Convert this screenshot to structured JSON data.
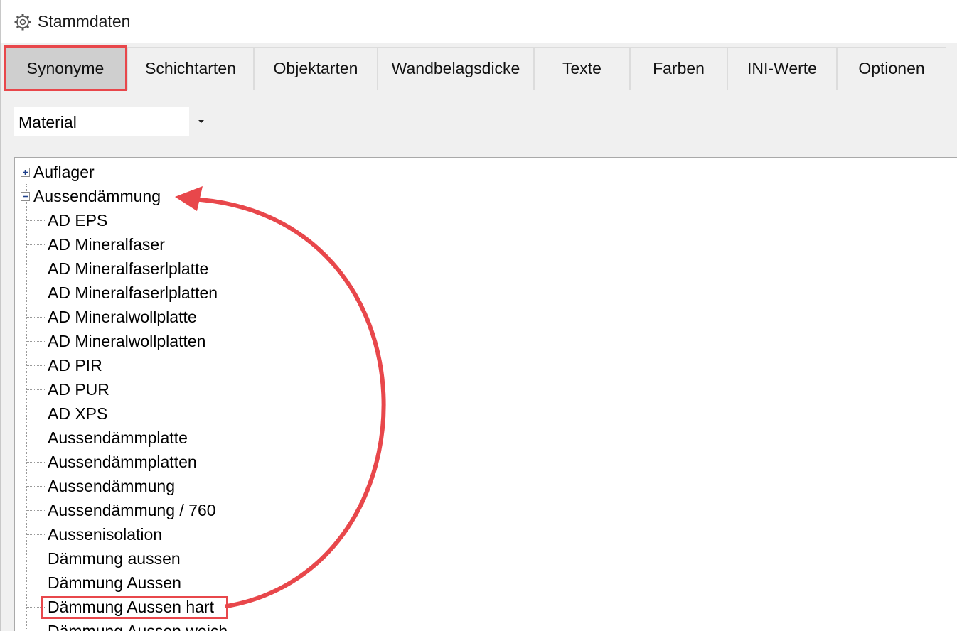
{
  "window": {
    "title": "Stammdaten"
  },
  "tabs": [
    {
      "label": "Synonyme",
      "active": true
    },
    {
      "label": "Schichtarten"
    },
    {
      "label": "Objektarten"
    },
    {
      "label": "Wandbelagsdicke"
    },
    {
      "label": "Texte"
    },
    {
      "label": "Farben"
    },
    {
      "label": "INI-Werte"
    },
    {
      "label": "Optionen"
    }
  ],
  "category_select": {
    "value": "Material"
  },
  "tree": {
    "nodes": [
      {
        "label": "Auflager",
        "expanded": false
      },
      {
        "label": "Aussendämmung",
        "expanded": true,
        "children": [
          "AD EPS",
          "AD Mineralfaser",
          "AD Mineralfaserlplatte",
          "AD Mineralfaserlplatten",
          "AD Mineralwollplatte",
          "AD Mineralwollplatten",
          "AD PIR",
          "AD PUR",
          "AD XPS",
          "Aussendämmplatte",
          "Aussendämmplatten",
          "Aussendämmung",
          "Aussendämmung / 760",
          "Aussenisolation",
          "Dämmung aussen",
          "Dämmung Aussen",
          "Dämmung Aussen hart",
          "Dämmung Aussen weich"
        ]
      }
    ]
  },
  "annotation": {
    "highlight_color": "#e8474b"
  }
}
